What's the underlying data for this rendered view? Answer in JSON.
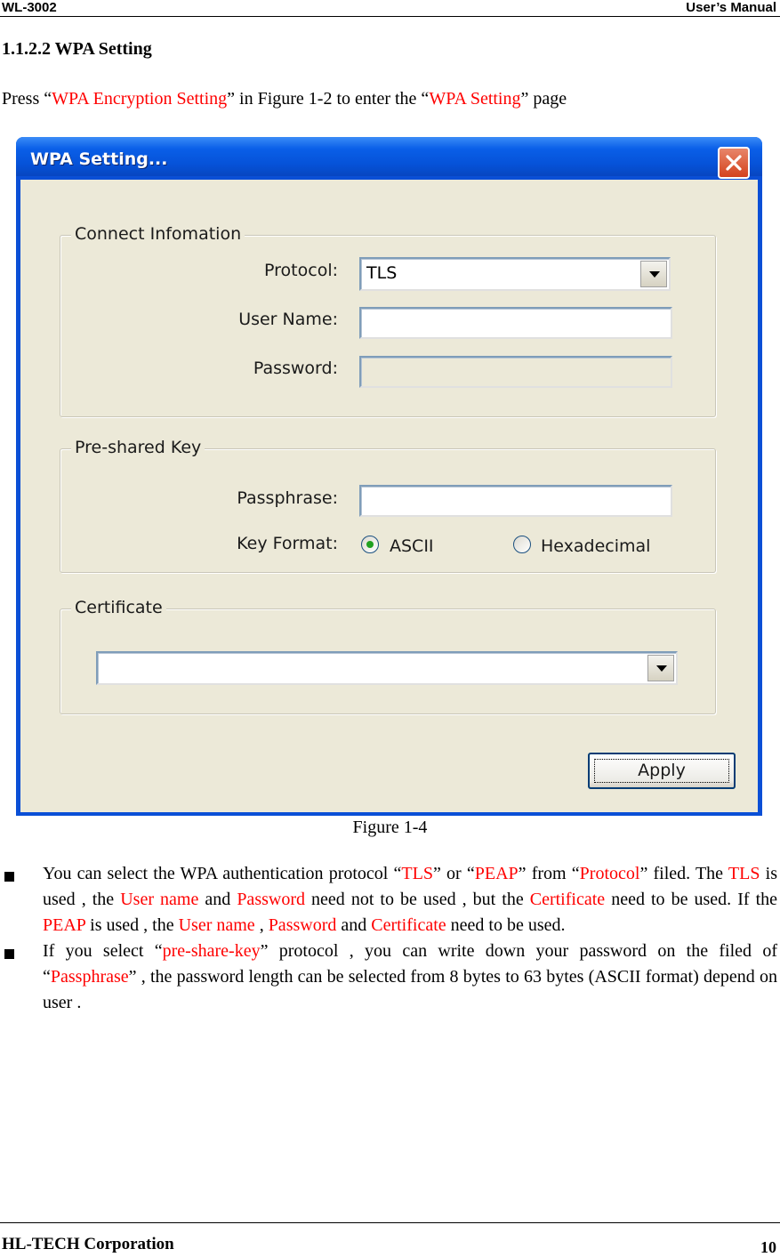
{
  "header": {
    "left": "WL-3002",
    "right": "User’s Manual"
  },
  "section_title": "1.1.2.2 WPA Setting",
  "intro": {
    "p1": "Press “",
    "r1": "WPA Encryption Setting",
    "p2": "” in Figure 1-2 to enter the “",
    "r2": "WPA Setting",
    "p3": "” page"
  },
  "dialog": {
    "title": "WPA Setting...",
    "connect_group": "Connect Infomation",
    "protocol_label": "Protocol:",
    "protocol_value": "TLS",
    "username_label": "User Name:",
    "username_value": "",
    "password_label": "Password:",
    "password_value": "",
    "psk_group": "Pre-shared Key",
    "passphrase_label": "Passphrase:",
    "passphrase_value": "",
    "keyformat_label": "Key Format:",
    "ascii_label": "ASCII",
    "hex_label": "Hexadecimal",
    "keyformat_selected": "ASCII",
    "cert_group": "Certificate",
    "cert_value": "",
    "apply_label": "Apply"
  },
  "caption": "Figure 1-4",
  "bullet1": {
    "a": "You can select the WPA authentication protocol “",
    "b": "TLS",
    "c": "” or “",
    "d": "PEAP",
    "e": "” from “",
    "f": "Protocol",
    "g": "” filed. The ",
    "h": "TLS",
    "i": " is used , the ",
    "j": "User name",
    "k": " and ",
    "l": "Password",
    "m": " need not to be used , but the ",
    "n": "Certificate",
    "o": " need to be used. If the ",
    "p": "PEAP",
    "q": " is used , the ",
    "r": "User name",
    "s": " , ",
    "t": "Password",
    "u": " and ",
    "v": "Certificate",
    "w": " need to be used."
  },
  "bullet2": {
    "a": "If you select “",
    "b": "pre-share-key",
    "c": "” protocol , you can write down your password on the filed of “",
    "d": "Passphrase",
    "e": "” , the password length can be selected from 8 bytes to 63 bytes (ASCII format) depend on user ."
  },
  "footer": {
    "left": "HL-TECH Corporation",
    "page": "10"
  },
  "colors": {
    "highlight": "#ff0000",
    "titlebar": "#0652d8",
    "dialog_bg": "#ece9d8"
  }
}
